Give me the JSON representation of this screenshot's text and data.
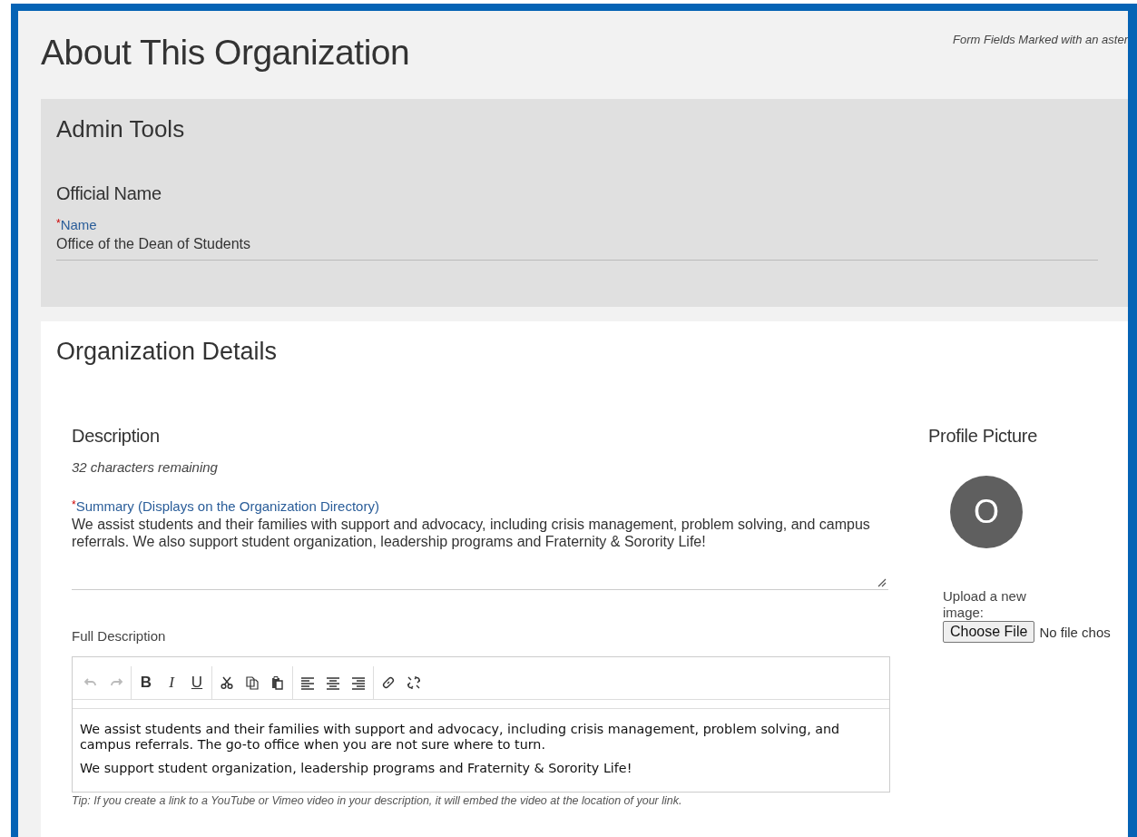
{
  "page": {
    "title": "About This Organization",
    "required_note": "Form Fields Marked with an aster"
  },
  "admin_tools": {
    "title": "Admin Tools",
    "section": "Official Name",
    "name_field": {
      "required_mark": "*",
      "label": "Name",
      "value": "Office of the Dean of Students"
    }
  },
  "organization_details": {
    "title": "Organization Details",
    "description": {
      "title": "Description",
      "remaining": "32 characters remaining",
      "summary": {
        "required_mark": "*",
        "label": "Summary (Displays on the Organization Directory)",
        "value": "We assist students and their families with support and advocacy, including crisis management, problem solving, and campus referrals. We also support student organization, leadership programs and Fraternity & Sorority Life!"
      },
      "full_description": {
        "label": "Full Description",
        "toolbar": [
          {
            "items": [
              {
                "kind": "undo",
                "disabled": true
              },
              {
                "kind": "redo",
                "disabled": true
              }
            ]
          },
          {
            "items": [
              {
                "kind": "bold",
                "label": "B",
                "disabled": false
              },
              {
                "kind": "italic",
                "label": "I",
                "disabled": false
              },
              {
                "kind": "underline",
                "label": "U",
                "disabled": false
              }
            ]
          },
          {
            "items": [
              {
                "kind": "cut",
                "disabled": false
              },
              {
                "kind": "copy",
                "disabled": false
              },
              {
                "kind": "paste",
                "disabled": false
              }
            ]
          },
          {
            "items": [
              {
                "kind": "align-left",
                "disabled": false
              },
              {
                "kind": "align-center",
                "disabled": false
              },
              {
                "kind": "align-right",
                "disabled": false
              }
            ]
          },
          {
            "items": [
              {
                "kind": "link",
                "disabled": false
              },
              {
                "kind": "unlink",
                "disabled": false
              }
            ]
          }
        ],
        "paragraphs": [
          "We assist students and their families with support and advocacy, including crisis management, problem solving, and campus referrals. The go-to office when you are not sure where to turn.",
          "We support student organization, leadership programs and Fraternity & Sorority Life!"
        ],
        "tip": "Tip: If you create a link to a YouTube or Vimeo video in your description, it will embed the video at the location of your link."
      }
    },
    "profile_picture": {
      "title": "Profile Picture",
      "initial": "O",
      "upload_label": "Upload a new image:",
      "button": "Choose File",
      "file_status": "No file chos"
    }
  }
}
